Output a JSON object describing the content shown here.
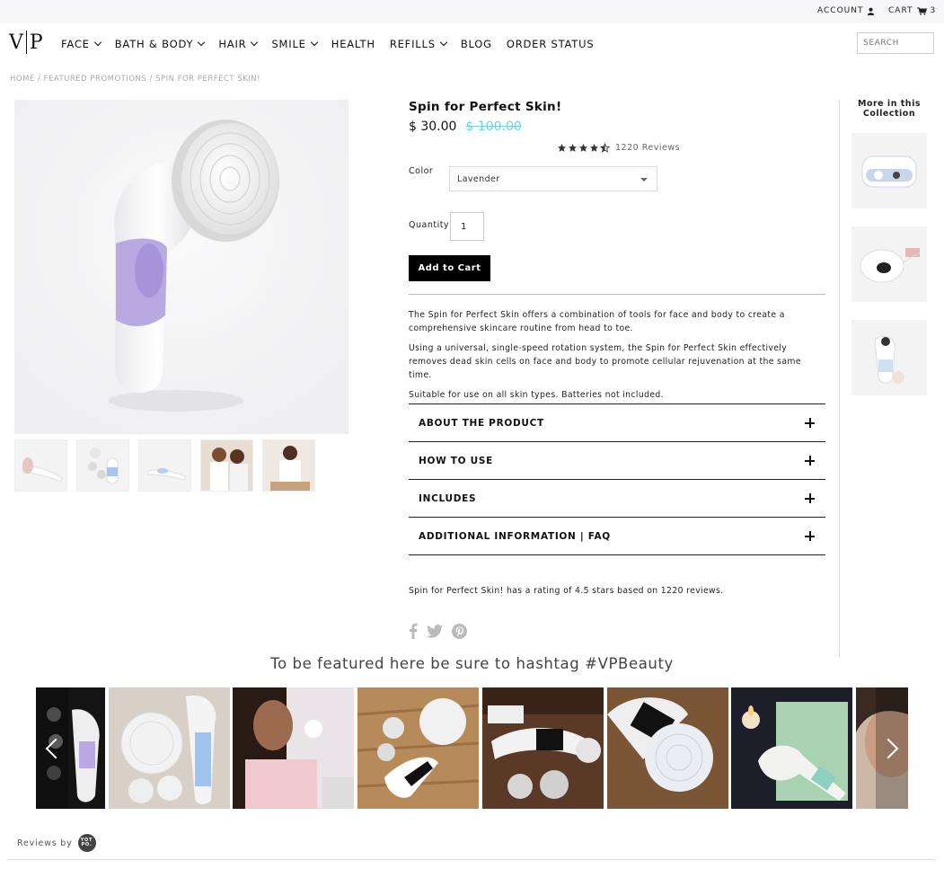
{
  "topbar": {
    "account_label": "ACCOUNT",
    "cart_label": "CART",
    "cart_count": "3"
  },
  "logo": {
    "left": "V",
    "right": "P"
  },
  "nav": {
    "items": [
      {
        "label": "FACE",
        "dropdown": true
      },
      {
        "label": "BATH & BODY",
        "dropdown": true
      },
      {
        "label": "HAIR",
        "dropdown": true
      },
      {
        "label": "SMILE",
        "dropdown": true
      },
      {
        "label": "HEALTH",
        "dropdown": false
      },
      {
        "label": "REFILLS",
        "dropdown": true
      },
      {
        "label": "BLOG",
        "dropdown": false
      },
      {
        "label": "ORDER STATUS",
        "dropdown": false
      }
    ],
    "search_placeholder": "SEARCH"
  },
  "breadcrumb": "HOME / FEATURED PROMOTIONS / SPIN FOR PERFECT SKIN!",
  "product": {
    "title": "Spin for Perfect Skin!",
    "price": "$ 30.00",
    "compare_price": "$ 100.00",
    "rating_value": 4.5,
    "reviews_label": "1220 Reviews",
    "color_label": "Color",
    "color_value": "Lavender",
    "quantity_label": "Quantity",
    "quantity_value": "1",
    "add_to_cart": "Add to Cart",
    "description": [
      "The Spin for Perfect Skin offers a combination of tools for face and body to create a comprehensive skincare routine from head to toe.",
      "Using a universal, single-speed rotation system, the Spin for Perfect Skin effectively removes dead skin cells on face and body to promote cellular rejuvenation at the same time.",
      "Suitable for use on all skin types. Batteries not included."
    ],
    "accordion": [
      "ABOUT THE PRODUCT",
      "HOW TO USE",
      "INCLUDES",
      "ADDITIONAL INFORMATION | FAQ"
    ],
    "rating_summary": "Spin for Perfect Skin! has a rating of 4.5 stars based on 1220 reviews."
  },
  "rail": {
    "title": "More in this Collection"
  },
  "hashtag": "To be featured here be sure to hashtag #VPBeauty",
  "footer": {
    "reviews_by": "Reviews by",
    "yotpo_logo": "YOTPO."
  },
  "colors": {
    "accent_strike": "#6fd1e6",
    "lavender": "#b9a9e2",
    "button": "#000000"
  }
}
